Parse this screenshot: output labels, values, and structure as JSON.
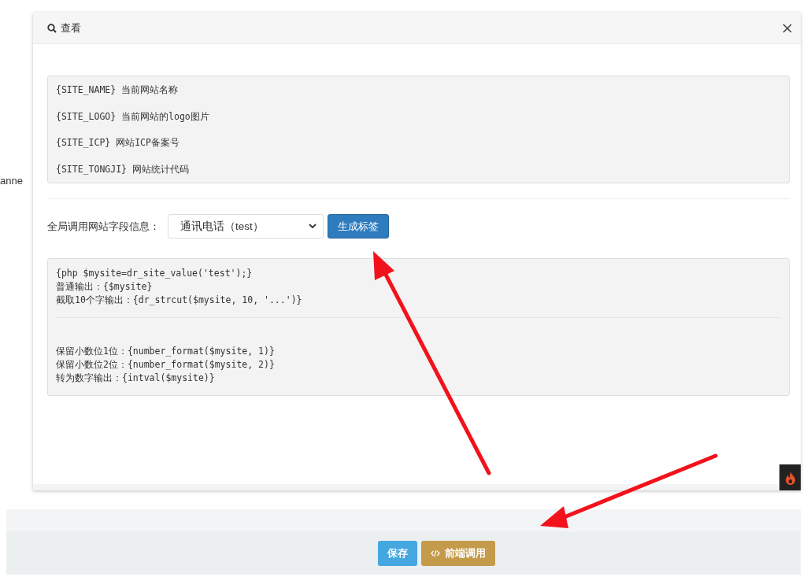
{
  "background": {
    "side_text": "anne"
  },
  "modal": {
    "title": "查看",
    "variables": [
      {
        "tag": "{SITE_NAME}",
        "desc": "当前网站名称"
      },
      {
        "tag": "{SITE_LOGO}",
        "desc": "当前网站的logo图片"
      },
      {
        "tag": "{SITE_ICP}",
        "desc": "网站ICP备案号"
      },
      {
        "tag": "{SITE_TONGJI}",
        "desc": "网站统计代码"
      }
    ],
    "field_label": "全局调用网站字段信息：",
    "field_select": "通讯电话（test）",
    "generate_button": "生成标签",
    "code_lines_top": [
      "{php $mysite=dr_site_value('test');}",
      "普通输出：{$mysite}",
      "截取10个字输出：{dr_strcut($mysite, 10, '...')}"
    ],
    "code_lines_bottom": [
      "保留小数位1位：{number_format($mysite, 1)}",
      "保留小数位2位：{number_format($mysite, 2)}",
      "转为数字输出：{intval($mysite)}"
    ]
  },
  "footer": {
    "buttons": [
      {
        "kind": "primary",
        "label": "保存"
      },
      {
        "kind": "code",
        "label": "前端调用"
      }
    ]
  }
}
